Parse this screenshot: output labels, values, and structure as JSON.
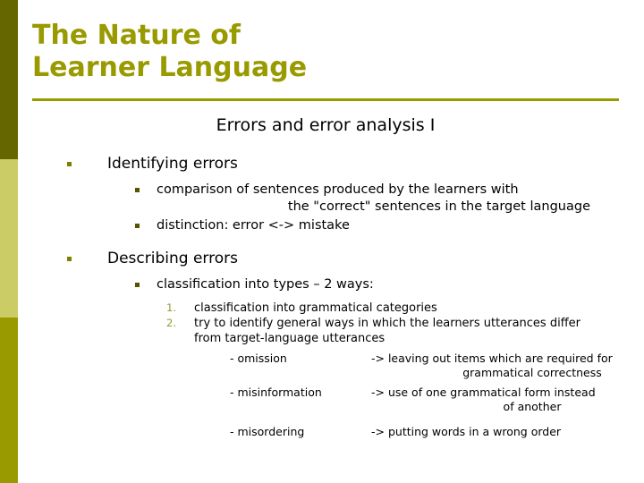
{
  "slide": {
    "title": "The Nature of\nLearner Language",
    "subtitle": "Errors and error analysis I",
    "colors": {
      "title": "#999900",
      "rule": "#999900",
      "sidebar_top": "#666600",
      "sidebar_middle": "#CCCC66",
      "sidebar_bottom": "#999900",
      "bullet": "#808000",
      "number": "#999933",
      "body_text": "#000000",
      "background": "#FFFFFF"
    }
  },
  "body": {
    "section1": {
      "heading": "Identifying errors",
      "points": [
        {
          "line1": "comparison of sentences produced by the learners with",
          "line2": "the \"correct\" sentences in the target language"
        },
        {
          "line1": "distinction: error <-> mistake"
        }
      ]
    },
    "section2": {
      "heading": "Describing errors",
      "point": "classification into types – 2 ways:",
      "numbered": [
        {
          "num": "1.",
          "line1": "classification into grammatical categories"
        },
        {
          "num": "2.",
          "line1": "try to identify general ways in which the learners utterances differ",
          "line2": "from target-language utterances"
        }
      ],
      "definitions": [
        {
          "term": "- omission",
          "def": "-> leaving out items which are required for",
          "def_cont": "grammatical correctness"
        },
        {
          "term": "- misinformation",
          "def": "-> use of one grammatical form instead",
          "def_cont": "of another"
        },
        {
          "term": "- misordering",
          "def": "-> putting words in a wrong order",
          "def_cont": ""
        }
      ]
    }
  }
}
